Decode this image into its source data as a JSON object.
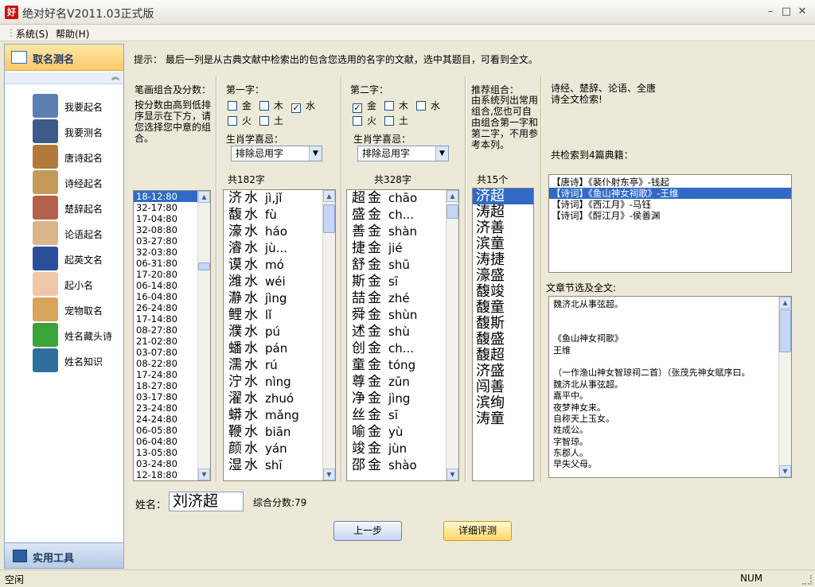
{
  "window": {
    "title": "绝对好名V2011.03正式版",
    "app_icon": "好",
    "min": "–",
    "max": "□",
    "close": "✕"
  },
  "menu": {
    "system": "系统(S)",
    "help": "帮助(H)"
  },
  "sidebar": {
    "header": "取名测名",
    "collapse": "︽",
    "items": [
      {
        "label": "我要起名",
        "icon": "person-icon",
        "color": "#5b7fb2"
      },
      {
        "label": "我要测名",
        "icon": "magnifier-person-icon",
        "color": "#3d5a8a"
      },
      {
        "label": "唐诗起名",
        "icon": "tang-poem-icon",
        "color": "#b07a3a"
      },
      {
        "label": "诗经起名",
        "icon": "poetry-classic-icon",
        "color": "#c49a5c"
      },
      {
        "label": "楚辞起名",
        "icon": "chuci-icon",
        "color": "#b5604a"
      },
      {
        "label": "论语起名",
        "icon": "analects-icon",
        "color": "#d9b58a"
      },
      {
        "label": "起英文名",
        "icon": "uk-flag-icon",
        "color": "#2a4f9c"
      },
      {
        "label": "起小名",
        "icon": "baby-icon",
        "color": "#efc7a8"
      },
      {
        "label": "宠物取名",
        "icon": "dog-icon",
        "color": "#d8a55a"
      },
      {
        "label": "姓名藏头诗",
        "icon": "poem-character-icon",
        "color": "#3aa33a"
      },
      {
        "label": "姓名知识",
        "icon": "globe-icon",
        "color": "#2f6f9e"
      }
    ],
    "footer": "实用工具"
  },
  "hint": "提示：  最后一列是从古典文献中检索出的包含您选用的名字的文献，选中其题目，可看到全文。",
  "strokes": {
    "title": "笔画组合及分数：",
    "desc": "按分数由高到低排序显示在下方，请您选择您中意的组合。",
    "items": [
      "18-12:80",
      "32-17:80",
      "17-04:80",
      "32-08:80",
      "03-27:80",
      "32-03:80",
      "06-31:80",
      "17-20:80",
      "06-14:80",
      "16-04:80",
      "26-24:80",
      "17-14:80",
      "08-27:80",
      "21-02:80",
      "03-07:80",
      "08-22:80",
      "17-24:80",
      "18-27:80",
      "03-17:80",
      "23-24:80",
      "24-24:80",
      "06-05:80",
      "06-04:80",
      "13-05:80",
      "03-24:80",
      "12-18:80"
    ]
  },
  "first_char": {
    "title": "第一字：",
    "elements": [
      {
        "label": "金",
        "checked": false
      },
      {
        "label": "木",
        "checked": false
      },
      {
        "label": "水",
        "checked": true
      },
      {
        "label": "火",
        "checked": false
      },
      {
        "label": "土",
        "checked": false
      }
    ],
    "zodiac_label": "生肖学喜忌：",
    "zodiac_value": "排除忌用字",
    "count": "共182字",
    "rows": [
      {
        "ch": "济",
        "el": "水",
        "py": "jì,jǐ"
      },
      {
        "ch": "馥",
        "el": "水",
        "py": "fù"
      },
      {
        "ch": "濠",
        "el": "水",
        "py": "háo"
      },
      {
        "ch": "濬",
        "el": "水",
        "py": "jù..."
      },
      {
        "ch": "谟",
        "el": "水",
        "py": "mó"
      },
      {
        "ch": "潍",
        "el": "水",
        "py": "wéi"
      },
      {
        "ch": "瀞",
        "el": "水",
        "py": "jìng"
      },
      {
        "ch": "鲤",
        "el": "水",
        "py": "lǐ"
      },
      {
        "ch": "濮",
        "el": "水",
        "py": "pú"
      },
      {
        "ch": "蟠",
        "el": "水",
        "py": "pán"
      },
      {
        "ch": "濡",
        "el": "水",
        "py": "rú"
      },
      {
        "ch": "泞",
        "el": "水",
        "py": "nìng"
      },
      {
        "ch": "濯",
        "el": "水",
        "py": "zhuó"
      },
      {
        "ch": "蟒",
        "el": "水",
        "py": "mǎng"
      },
      {
        "ch": "鞭",
        "el": "水",
        "py": "biān"
      },
      {
        "ch": "颜",
        "el": "水",
        "py": "yán"
      },
      {
        "ch": "湿",
        "el": "水",
        "py": "shī"
      }
    ]
  },
  "second_char": {
    "title": "第二字：",
    "elements": [
      {
        "label": "金",
        "checked": true
      },
      {
        "label": "木",
        "checked": false
      },
      {
        "label": "水",
        "checked": false
      },
      {
        "label": "火",
        "checked": false
      },
      {
        "label": "土",
        "checked": false
      }
    ],
    "zodiac_label": "生肖学喜忌：",
    "zodiac_value": "排除忌用字",
    "count": "共328字",
    "rows": [
      {
        "ch": "超",
        "el": "金",
        "py": "chāo"
      },
      {
        "ch": "盛",
        "el": "金",
        "py": "ch..."
      },
      {
        "ch": "善",
        "el": "金",
        "py": "shàn"
      },
      {
        "ch": "捷",
        "el": "金",
        "py": "jié"
      },
      {
        "ch": "舒",
        "el": "金",
        "py": "shū"
      },
      {
        "ch": "斯",
        "el": "金",
        "py": "sī"
      },
      {
        "ch": "喆",
        "el": "金",
        "py": "zhé"
      },
      {
        "ch": "舜",
        "el": "金",
        "py": "shùn"
      },
      {
        "ch": "述",
        "el": "金",
        "py": "shù"
      },
      {
        "ch": "创",
        "el": "金",
        "py": "ch..."
      },
      {
        "ch": "童",
        "el": "金",
        "py": "tóng"
      },
      {
        "ch": "尊",
        "el": "金",
        "py": "zūn"
      },
      {
        "ch": "净",
        "el": "金",
        "py": "jìng"
      },
      {
        "ch": "丝",
        "el": "金",
        "py": "sī"
      },
      {
        "ch": "喻",
        "el": "金",
        "py": "yù"
      },
      {
        "ch": "竣",
        "el": "金",
        "py": "jùn"
      },
      {
        "ch": "邵",
        "el": "金",
        "py": "shào"
      }
    ]
  },
  "recommend": {
    "title": "推荐组合：",
    "desc": "由系统列出常用组合,您也可自由组合第一字和第二字，不用参考本列。",
    "count": "共15个",
    "items": [
      "济超",
      "涛超",
      "济善",
      "滨童",
      "涛捷",
      "濠盛",
      "馥竣",
      "馥童",
      "馥斯",
      "馥盛",
      "馥超",
      "济盛",
      "闯善",
      "滨绚",
      "涛童"
    ]
  },
  "classics": {
    "title": "诗经、楚辞、论语、全唐诗全文检索!",
    "found": "共检索到4篇典籍：",
    "items": [
      "【唐诗】《裴仆射东亭》-钱起",
      "【诗词】《鱼山神女祠歌》-王维",
      "【诗词】《西江月》-马钰",
      "【诗词】《酹江月》-侯善渊"
    ],
    "excerpt_label": "文章节选及全文:",
    "excerpt_lines": [
      "魏济北从事弦超。",
      "",
      "",
      "《鱼山神女祠歌》",
      "王维",
      "",
      "（一作渔山神女智琼祠二首）（张茂先神女赋序曰。",
      "魏济北从事弦超。",
      "嘉平中。",
      "夜梦神女来。",
      "自称天上玉女。",
      "姓成公。",
      "字智琼。",
      "东郡人。",
      "早失父母。"
    ]
  },
  "name": {
    "label": "姓名：",
    "value": "刘济超",
    "score": "综合分数:79"
  },
  "buttons": {
    "prev": "上一步",
    "detail": "详细评测"
  },
  "status": {
    "left": "空闲",
    "num": "NUM"
  }
}
